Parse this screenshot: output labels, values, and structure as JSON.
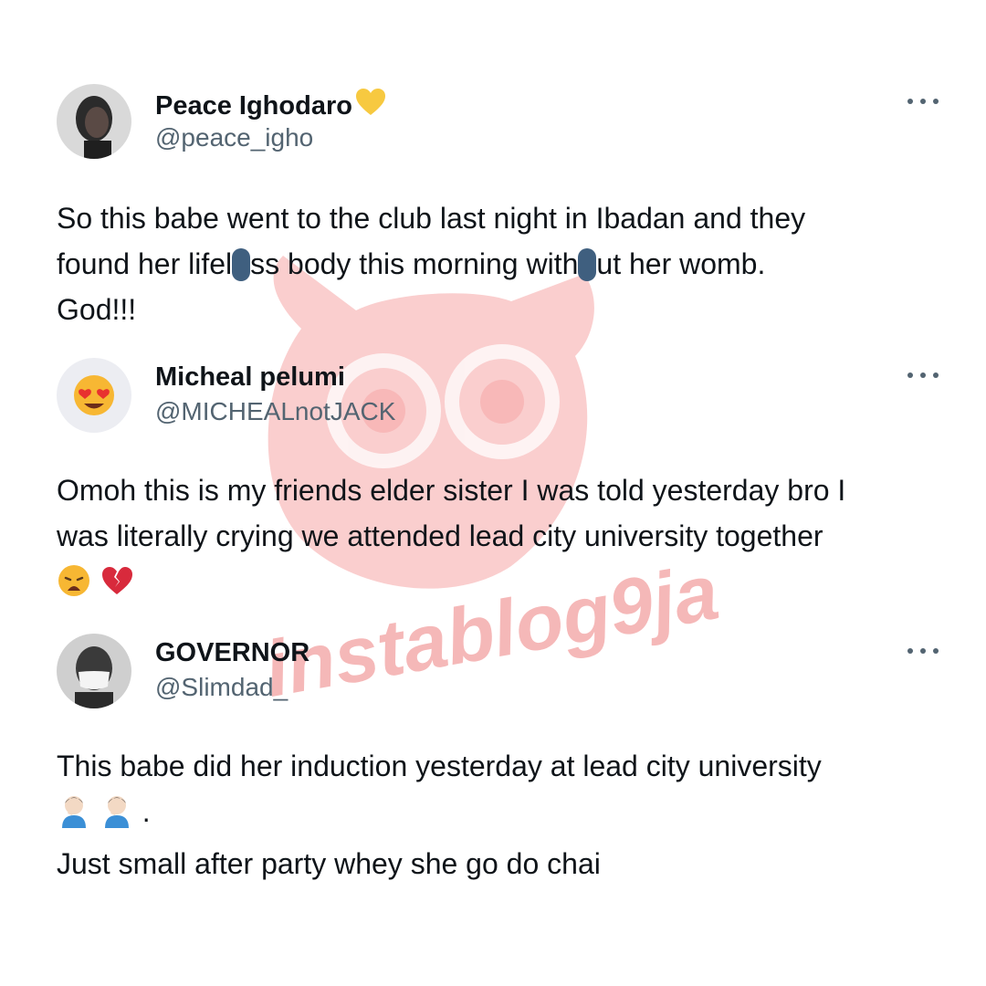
{
  "tweets": [
    {
      "name": "Peace Ighodaro",
      "handle": "@peace_igho",
      "name_emoji": "yellow-heart",
      "body": {
        "l1": "So this babe went to the club last night in Ibadan and they",
        "l2a": "found her lifel",
        "l2b": "ss body this morning with",
        "l2c": "ut her womb.",
        "l3": "God!!!"
      }
    },
    {
      "name": "Micheal pelumi",
      "handle": "@MICHEALnotJACK",
      "avatar_icon": "heart-eyes-emoji",
      "body": {
        "l1": "Omoh this is my friends elder sister I was told yesterday bro I",
        "l2": "was literally crying we attended lead city university together"
      },
      "emojis": [
        "weary-face",
        "broken-heart"
      ]
    },
    {
      "name": "GOVERNOR",
      "handle": "@Slimdad_",
      "body": {
        "l1": "This babe did her induction yesterday at lead city university",
        "l2_suffix": ".",
        "l3": "Just small after party whey she go do chai"
      },
      "emojis": [
        "man-facepalming",
        "man-facepalming"
      ]
    }
  ],
  "watermark": {
    "text": "instablog9ja",
    "color": "#f08a8a"
  }
}
